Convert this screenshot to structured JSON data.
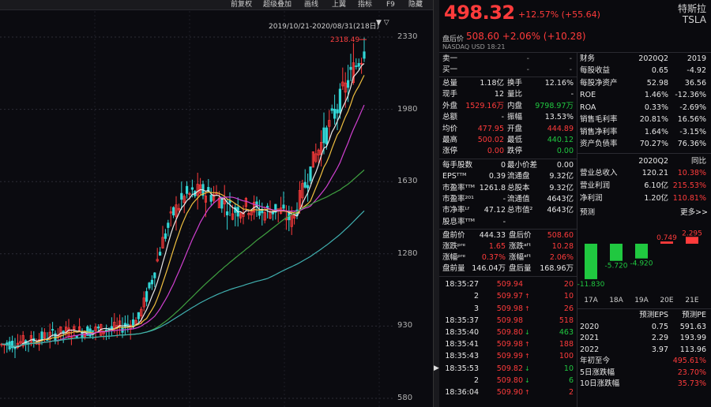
{
  "toolbar": {
    "items": [
      "前复权",
      "超级叠加",
      "画线",
      "上翼",
      "指标",
      "F9",
      "隐藏"
    ]
  },
  "chart": {
    "date_range": "2019/10/21-2020/08/31(218日)",
    "y_axis_labels": [
      "2330",
      "1980",
      "1630",
      "1280",
      "930",
      "580"
    ],
    "peak_label": "2318.49",
    "colors": {
      "up": "#ff3b3b",
      "down": "#33d6d6",
      "ma5": "#e8e8e8",
      "ma10": "#f0c040",
      "ma20": "#d040d0",
      "ma60": "#3fa040",
      "ma120": "#40b0b0"
    }
  },
  "header": {
    "price": "498.32",
    "change": "+12.57% (+55.64)",
    "name_cn": "特斯拉",
    "ticker": "TSLA",
    "ah_label": "盘后价",
    "ah_price": "508.60 +2.06% (+10.28)",
    "exchange": "NASDAQ  USD  18:21"
  },
  "orderbook": [
    {
      "label": "卖一",
      "v1": "-",
      "v2": "-"
    },
    {
      "label": "买一",
      "v1": "-",
      "v2": "-"
    }
  ],
  "stats": [
    {
      "l1": "总量",
      "v1": "1.18亿",
      "c1": "w",
      "l2": "换手",
      "v2": "12.16%",
      "c2": "w"
    },
    {
      "l1": "现手",
      "v1": "12",
      "c1": "w",
      "l2": "量比",
      "v2": "-",
      "c2": "w"
    },
    {
      "l1": "外盘",
      "v1": "1529.16万",
      "c1": "r",
      "l2": "内盘",
      "v2": "9798.97万",
      "c2": "g"
    },
    {
      "l1": "总额",
      "v1": "-",
      "c1": "w",
      "l2": "振幅",
      "v2": "13.53%",
      "c2": "w"
    },
    {
      "l1": "均价",
      "v1": "477.95",
      "c1": "r",
      "l2": "开盘",
      "v2": "444.89",
      "c2": "r"
    },
    {
      "l1": "最高",
      "v1": "500.02",
      "c1": "r",
      "l2": "最低",
      "v2": "440.12",
      "c2": "g"
    },
    {
      "l1": "涨停",
      "v1": "0.00",
      "c1": "r",
      "l2": "跌停",
      "v2": "0.00",
      "c2": "g"
    }
  ],
  "stats2": [
    {
      "l1": "每手股数",
      "v1": "0",
      "l2": "最小价差",
      "v2": "0.00"
    },
    {
      "l1": "EPSᵀᵀᴹ",
      "v1": "0.39",
      "l2": "流通盘",
      "v2": "9.32亿"
    },
    {
      "l1": "市盈率ᵀᵀᴹ",
      "v1": "1261.8",
      "l2": "总股本",
      "v2": "9.32亿"
    },
    {
      "l1": "市盈率²⁰¹",
      "v1": "-",
      "l2": "流通值",
      "v2": "4643亿"
    },
    {
      "l1": "市净率ᴸᶠ",
      "v1": "47.12",
      "l2": "总市值²",
      "v2": "4643亿"
    },
    {
      "l1": "股息率ᵀᵀᴹ",
      "v1": "-",
      "l2": "",
      "v2": ""
    }
  ],
  "pre_after": [
    {
      "l1": "盘前价",
      "v1": "444.33",
      "c1": "w",
      "l2": "盘后价",
      "v2": "508.60",
      "c2": "r"
    },
    {
      "l1": "涨跌ᵖʳᵉ",
      "v1": "1.65",
      "c1": "r",
      "l2": "涨跌ᵃᶠᵗ",
      "v2": "10.28",
      "c2": "r"
    },
    {
      "l1": "涨幅ᵖʳᵉ",
      "v1": "0.37%",
      "c1": "r",
      "l2": "涨幅ᵃᶠᵗ",
      "v2": "2.06%",
      "c2": "r"
    },
    {
      "l1": "盘前量",
      "v1": "146.04万",
      "c1": "w",
      "l2": "盘后量",
      "v2": "168.96万",
      "c2": "w"
    }
  ],
  "ticks": [
    {
      "t": "18:35:27",
      "p": "509.94",
      "d": "",
      "v": "20",
      "vc": "r"
    },
    {
      "t": "2",
      "p": "509.97",
      "d": "up",
      "v": "10",
      "vc": "r"
    },
    {
      "t": "3",
      "p": "509.98",
      "d": "up",
      "v": "26",
      "vc": "r"
    },
    {
      "t": "18:35:37",
      "p": "509.98",
      "d": "",
      "v": "518",
      "vc": "r"
    },
    {
      "t": "18:35:40",
      "p": "509.80",
      "d": "dn",
      "v": "463",
      "vc": "g"
    },
    {
      "t": "18:35:41",
      "p": "509.98",
      "d": "up",
      "v": "188",
      "vc": "r"
    },
    {
      "t": "18:35:43",
      "p": "509.99",
      "d": "up",
      "v": "100",
      "vc": "r"
    },
    {
      "t": "18:35:53",
      "p": "509.82",
      "d": "dn",
      "v": "10",
      "vc": "g"
    },
    {
      "t": "2",
      "p": "509.80",
      "d": "dn",
      "v": "6",
      "vc": "g"
    },
    {
      "t": "18:36:04",
      "p": "509.90",
      "d": "up",
      "v": "2",
      "vc": "r"
    }
  ],
  "financials": {
    "header": [
      "财务",
      "2020Q2",
      "2019"
    ],
    "rows": [
      {
        "l": "每股收益",
        "a": "0.65",
        "ac": "w",
        "b": "-4.92",
        "bc": "w"
      },
      {
        "l": "每股净资产",
        "a": "52.98",
        "ac": "w",
        "b": "36.56",
        "bc": "w"
      },
      {
        "l": "ROE",
        "a": "1.46%",
        "ac": "w",
        "b": "-12.36%",
        "bc": "w"
      },
      {
        "l": "ROA",
        "a": "0.33%",
        "ac": "w",
        "b": "-2.69%",
        "bc": "w"
      },
      {
        "l": "销售毛利率",
        "a": "20.81%",
        "ac": "w",
        "b": "16.56%",
        "bc": "w"
      },
      {
        "l": "销售净利率",
        "a": "1.64%",
        "ac": "w",
        "b": "-3.15%",
        "bc": "w"
      },
      {
        "l": "资产负债率",
        "a": "70.27%",
        "ac": "w",
        "b": "76.36%",
        "bc": "w"
      }
    ],
    "header2": [
      "",
      "2020Q2",
      "同比"
    ],
    "rows2": [
      {
        "l": "营业总收入",
        "a": "120.21",
        "ac": "w",
        "b": "10.38%",
        "bc": "r"
      },
      {
        "l": "营业利润",
        "a": "6.10亿",
        "ac": "w",
        "b": "215.53%",
        "bc": "r"
      },
      {
        "l": "净利润",
        "a": "1.20亿",
        "ac": "w",
        "b": "110.81%",
        "bc": "r"
      }
    ]
  },
  "forecast": {
    "title": "预测",
    "more": "更多>>",
    "bars": [
      {
        "label": "17A",
        "value": -11.83,
        "text": "-11.830"
      },
      {
        "label": "18A",
        "value": -5.72,
        "text": "-5.720"
      },
      {
        "label": "19A",
        "value": -4.92,
        "text": "-4.920"
      },
      {
        "label": "20E",
        "value": 0.749,
        "text": "0.749"
      },
      {
        "label": "21E",
        "value": 2.295,
        "text": "2.295"
      }
    ],
    "table_header": [
      "",
      "预测EPS",
      "预测PE"
    ],
    "table": [
      {
        "y": "2020",
        "eps": "0.75",
        "pe": "591.63"
      },
      {
        "y": "2021",
        "eps": "2.29",
        "pe": "193.99"
      },
      {
        "y": "2022",
        "eps": "3.97",
        "pe": "113.96"
      }
    ],
    "ytd": [
      {
        "l": "年初至今",
        "v": "495.61%"
      },
      {
        "l": "5日涨跌幅",
        "v": "23.70%"
      },
      {
        "l": "10日涨跌幅",
        "v": "35.73%"
      }
    ]
  }
}
